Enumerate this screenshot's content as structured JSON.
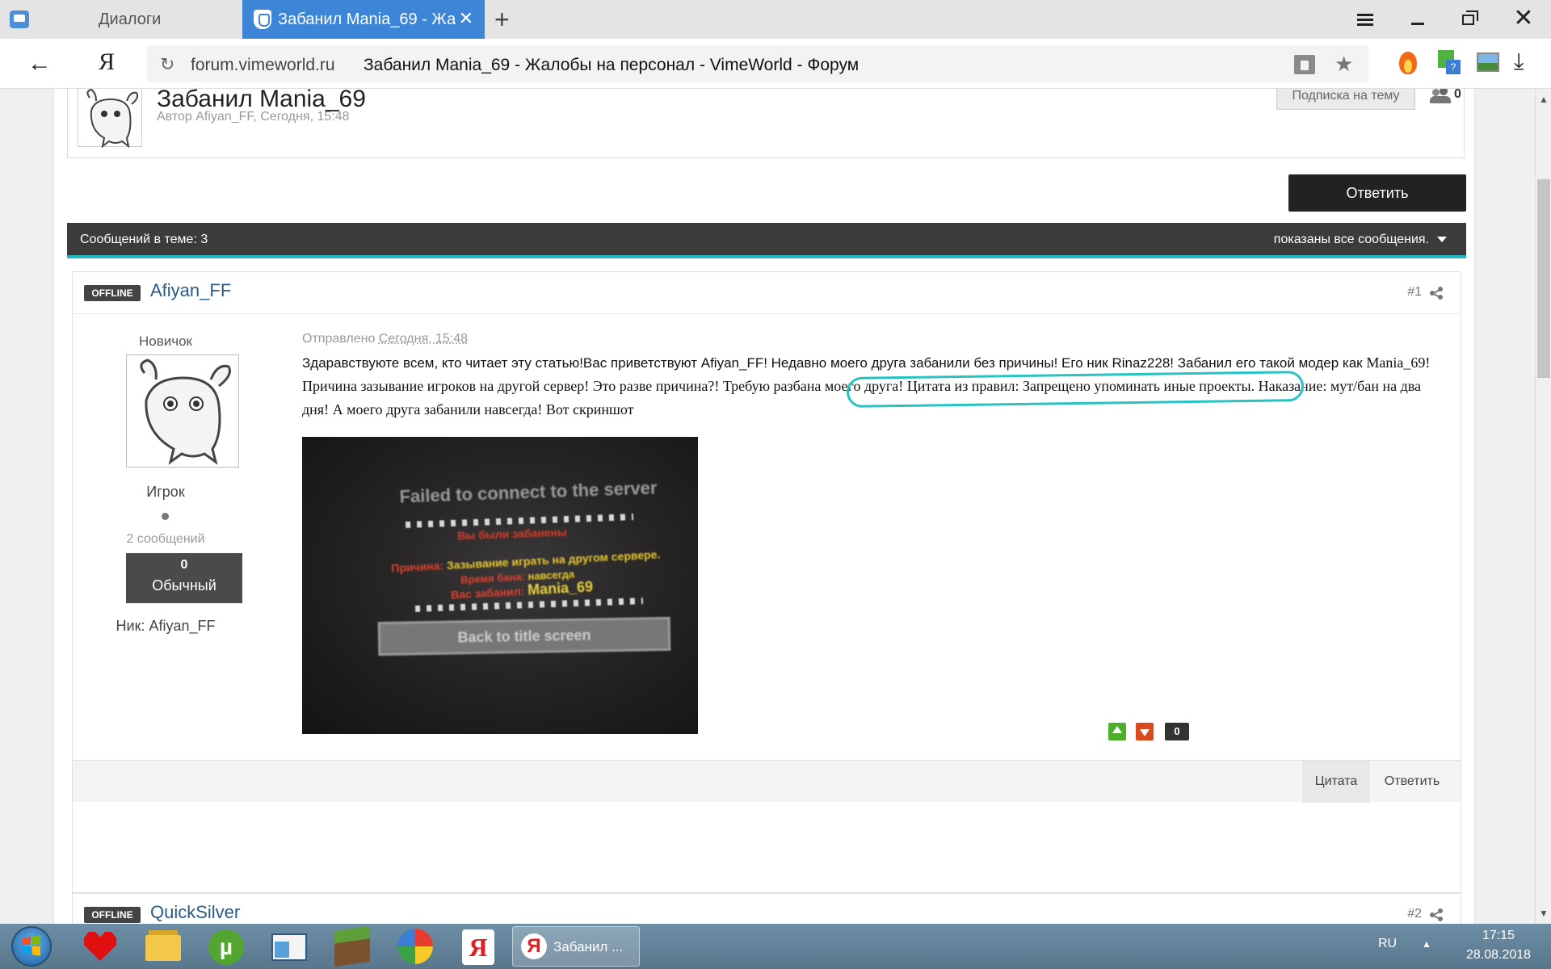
{
  "browser": {
    "tabs": [
      {
        "label": "Диалоги"
      },
      {
        "label": "Забанил Mania_69 - Жалобы на персонал - VimeWorld - Форум"
      }
    ],
    "new_tab": "+",
    "close_symbol": "✕",
    "back_symbol": "←",
    "yandex_button": "Я",
    "reload_symbol": "↻",
    "url_domain": "forum.vimeworld.ru",
    "page_title": "Забанил Mania_69 - Жалобы на персонал - VimeWorld - Форум",
    "star_symbol": "★",
    "download_symbol": "⤓",
    "extension_badge": "?",
    "icons": [
      "fire-icon",
      "puzzle-extension-icon",
      "photo-icon",
      "download-icon"
    ]
  },
  "topic": {
    "title": "Забанил Mania_69",
    "meta": "Автор Afiyan_FF, Сегодня, 15:48",
    "subscribe_label": "Подписка на тему",
    "followers": "0",
    "reply_label": "Ответить",
    "message_count": "Сообщений в теме: 3",
    "filter_label": "показаны все сообщения."
  },
  "post1": {
    "status": "OFFLINE",
    "author": "Afiyan_FF",
    "number": "#1",
    "rank": "Новичок",
    "group": "Игрок",
    "posts_count": "2 сообщений",
    "reputation_value": "0",
    "reputation_label": "Обычный",
    "nick": "Ник: Afiyan_FF",
    "date_prefix": "Отправлено",
    "date": "Сегодня, 15:48",
    "text_part1": "Здаравствуюте всем, кто читает эту статью!Вас приветствуют Afiyan_FF! Недавно моего друга забанили без причины! Его ник Rinaz228! Забанил его такой модер как",
    "text_part2": "Mania_69! Причина зазывание игроков на другой сервер! Это разве причина?! Требую разбана моего друга! Цитата из правил: Запрещено упоминать иные проекты. Наказание: мут/бан на два дня! А моего друга забанили навсегда! Вот скриншот",
    "screenshot": {
      "title": "Failed to connect to the server",
      "ban_line": "Вы были забанены",
      "reason_label": "Причина:",
      "reason": "Зазывание играть на другом сервере.",
      "time_label": "Время бана:",
      "time": "навсегда",
      "by_label": "Вас забанил:",
      "by": "Mania_69",
      "back_button": "Back to title screen"
    },
    "vote_count": "0",
    "quote_label": "Цитата",
    "reply_label": "Ответить",
    "highlight_color": "#29c2c2"
  },
  "post2": {
    "status": "OFFLINE",
    "author": "QuickSilver",
    "number": "#2"
  },
  "taskbar": {
    "active_window_label": "Забанил ...",
    "yandex_letter": "Я",
    "torrent_letter": "µ",
    "language": "RU",
    "tray_arrow": "▲",
    "time": "17:15",
    "date": "28.08.2018",
    "apps": [
      "heart-app-icon",
      "file-explorer-icon",
      "utorrent-icon",
      "window-app-icon",
      "minecraft-icon",
      "colorful-game-icon",
      "yandex-browser-icon"
    ]
  },
  "colors": {
    "tab_active": "#3d85d6",
    "topic_bar": "#3b3b3b",
    "topic_bar_accent": "#1fb8c4",
    "author_link": "#2b5a86",
    "rep_up": "#4caf2a",
    "rep_down": "#d84a1e"
  }
}
